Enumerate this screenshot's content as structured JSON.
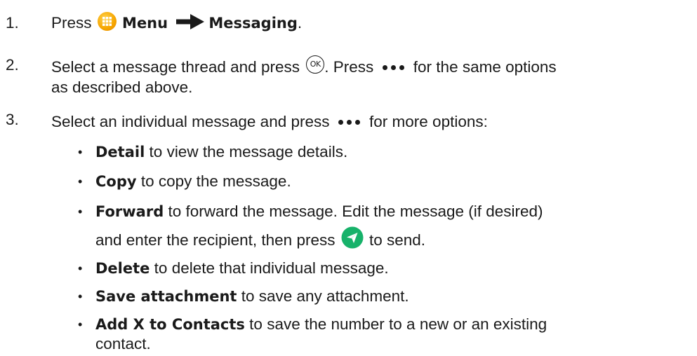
{
  "steps": [
    {
      "number": "1.",
      "parts": {
        "press": "Press",
        "menu": "Menu",
        "messaging": "Messaging",
        "end": "."
      }
    },
    {
      "number": "2.",
      "line1a": "Select a message thread and press",
      "ok_label": "OK",
      "line1b": ". Press",
      "line1c": "for the same options",
      "line2": "as described above."
    },
    {
      "number": "3.",
      "line1a": "Select an individual message and press",
      "line1b": "for more options:"
    }
  ],
  "bullets": [
    {
      "bullet": "•",
      "term": "Detail",
      "text": "to view the message details."
    },
    {
      "bullet": "•",
      "term": "Copy",
      "text": "to copy the message."
    },
    {
      "bullet": "•",
      "term": "Forward",
      "text": "to forward the message. Edit the message (if desired)",
      "line2a": "and enter the recipient, then press",
      "line2b": "to send."
    },
    {
      "bullet": "•",
      "term": "Delete",
      "text": "to delete that individual message."
    },
    {
      "bullet": "•",
      "term": "Save attachment",
      "text": "to save any attachment."
    },
    {
      "bullet": "•",
      "term": "Add X to Contacts",
      "text": "to save the number to a new or an existing",
      "line2": "contact."
    }
  ],
  "icons": {
    "menu": "menu-grid-icon",
    "arrow": "right-arrow-icon",
    "ok": "ok-button-icon",
    "more": "more-dots-icon",
    "send": "send-icon"
  },
  "colors": {
    "menu_icon": "#f6a500",
    "send_icon": "#17b26a",
    "text": "#1a1a1a"
  }
}
